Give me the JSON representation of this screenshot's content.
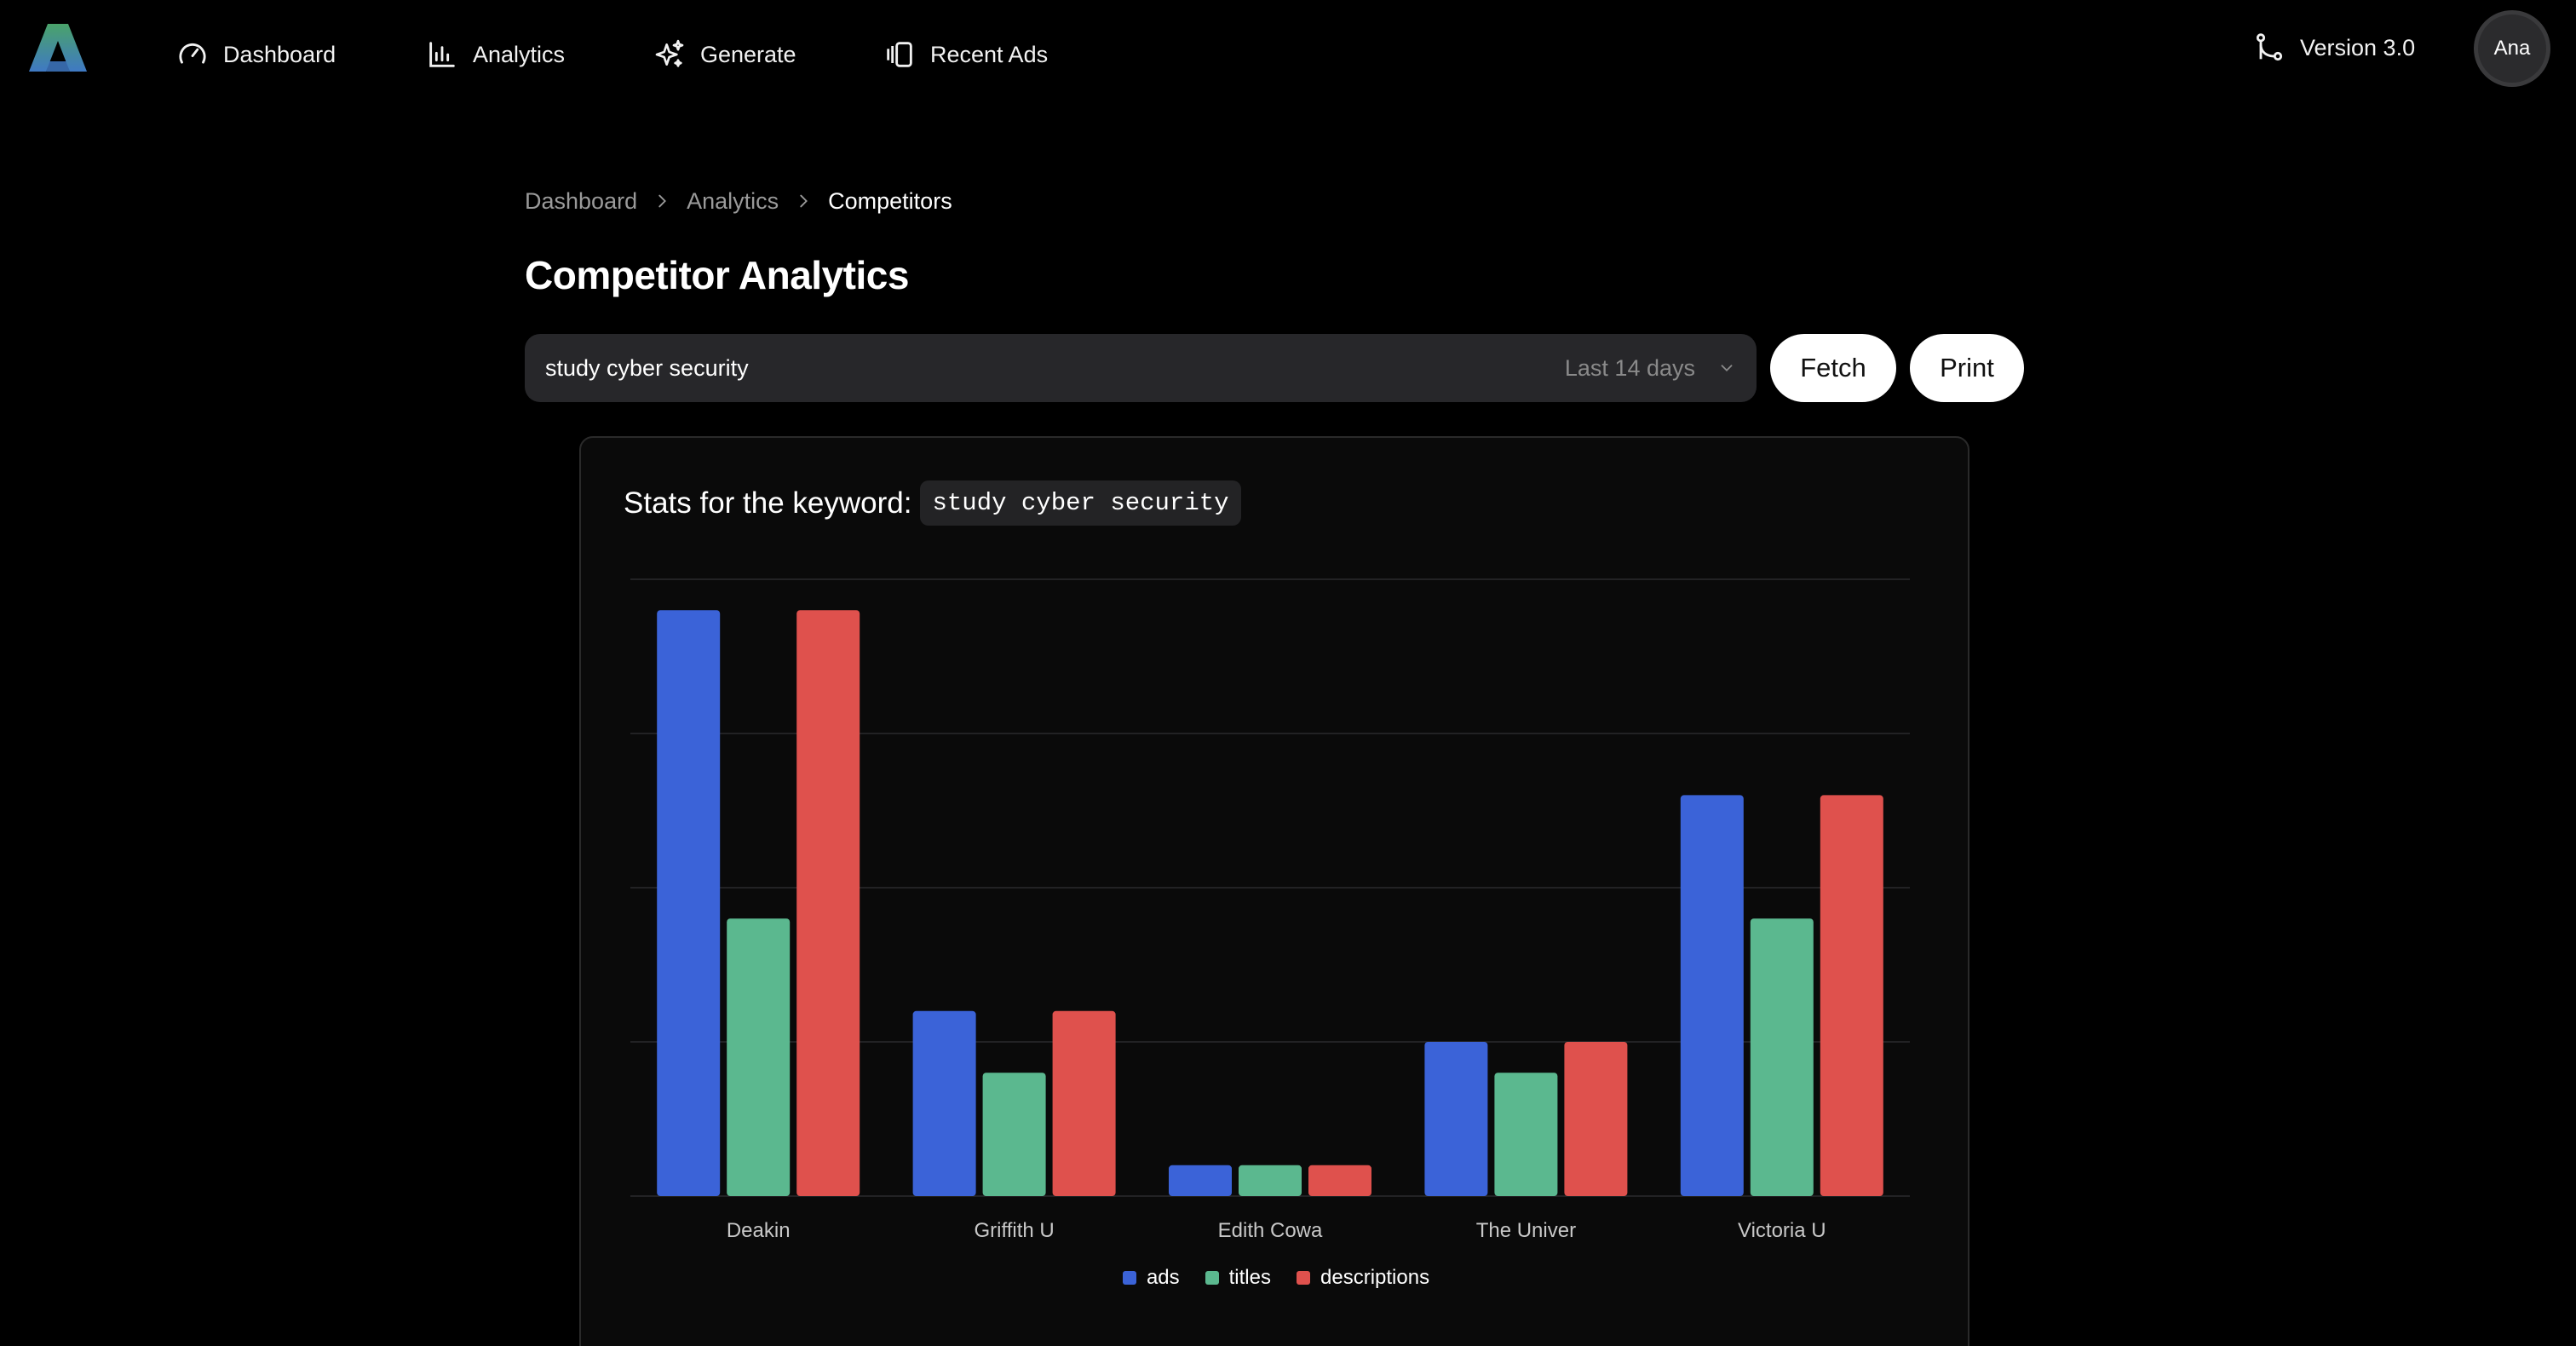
{
  "nav": {
    "items": [
      {
        "label": "Dashboard",
        "icon": "gauge-icon"
      },
      {
        "label": "Analytics",
        "icon": "bar-chart-icon"
      },
      {
        "label": "Generate",
        "icon": "sparkles-icon"
      },
      {
        "label": "Recent Ads",
        "icon": "gallery-icon"
      }
    ],
    "version": "Version 3.0",
    "avatar": "Ana"
  },
  "breadcrumb": [
    "Dashboard",
    "Analytics",
    "Competitors"
  ],
  "page_title": "Competitor Analytics",
  "search": {
    "value": "study cyber security",
    "range": "Last 14 days"
  },
  "buttons": {
    "fetch": "Fetch",
    "print": "Print"
  },
  "card": {
    "heading": "Stats for the keyword:",
    "keyword": "study cyber security"
  },
  "colors": {
    "ads": "#3b63d8",
    "titles": "#5bb88f",
    "descriptions": "#df514d",
    "logo_top": "#4aa36a",
    "logo_bottom": "#3f79c4"
  },
  "chart_data": {
    "type": "bar",
    "categories": [
      "Deakin",
      "Griffith U",
      "Edith Cowa",
      "The Univer",
      "Victoria U"
    ],
    "series": [
      {
        "name": "ads",
        "values": [
          19,
          6,
          1,
          5,
          13
        ]
      },
      {
        "name": "titles",
        "values": [
          9,
          4,
          1,
          4,
          9
        ]
      },
      {
        "name": "descriptions",
        "values": [
          19,
          6,
          1,
          5,
          13
        ]
      }
    ],
    "ylim": [
      0,
      20
    ],
    "grid": true,
    "legend": "bottom-center"
  }
}
